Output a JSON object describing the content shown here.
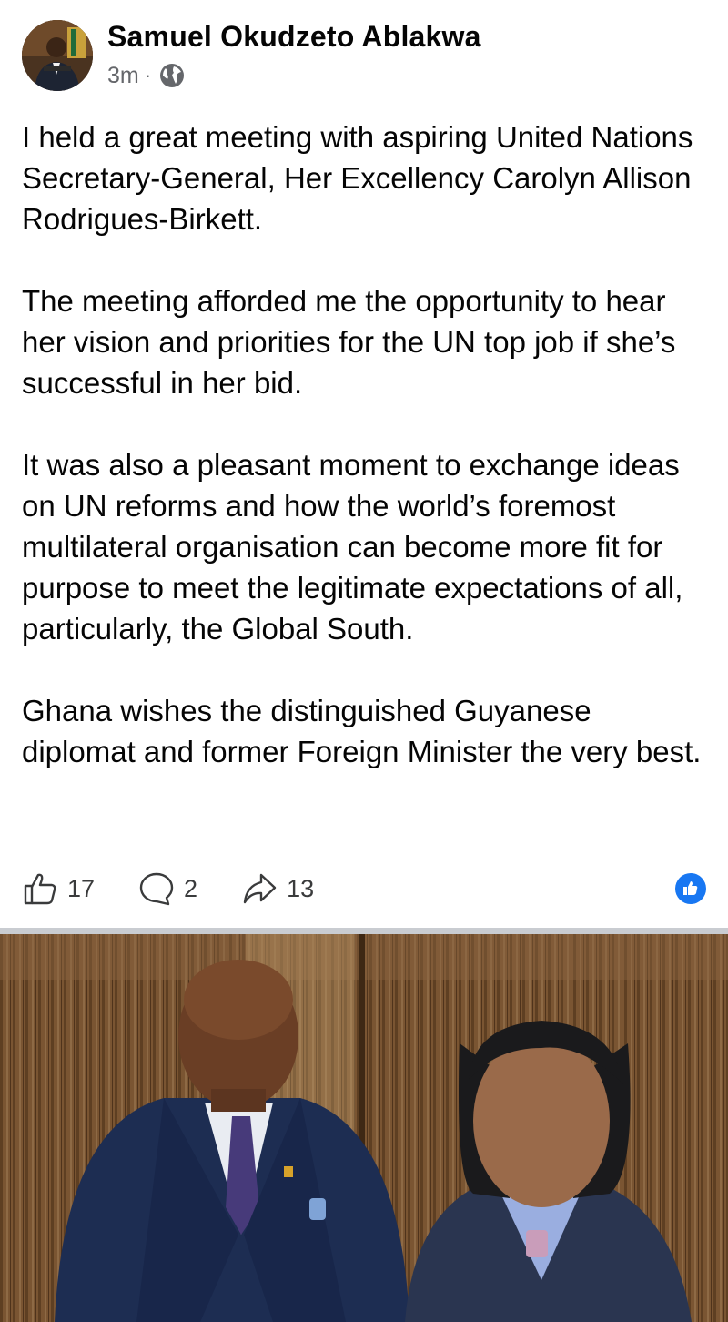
{
  "post": {
    "author": "Samuel Okudzeto Ablakwa",
    "time": "3m",
    "separator": "·",
    "paragraphs": [
      "I held a great meeting with aspiring United Nations Secretary-General, Her Excellency Carolyn Allison Rodrigues-Birkett.",
      "The meeting afforded me the opportunity to hear her vision and priorities for the UN top job if she’s successful in her bid.",
      "It was also a pleasant moment to exchange ideas on UN reforms and how the world’s foremost multilateral organisation can become more fit for purpose to meet the legitimate expectations of all, particularly, the Global South.",
      "Ghana wishes the distinguished Guyanese diplomat and former Foreign Minister the very best."
    ],
    "likes": "17",
    "comments": "2",
    "shares": "13"
  },
  "icons": {
    "privacy": "globe-icon",
    "like": "thumbs-up-icon",
    "comment": "comment-bubble-icon",
    "share": "share-arrow-icon",
    "reaction": "like-reaction-icon"
  },
  "colors": {
    "accent": "#1877f2",
    "text": "#050505",
    "secondary_text": "#65676b",
    "divider": "#c9ccd1"
  }
}
